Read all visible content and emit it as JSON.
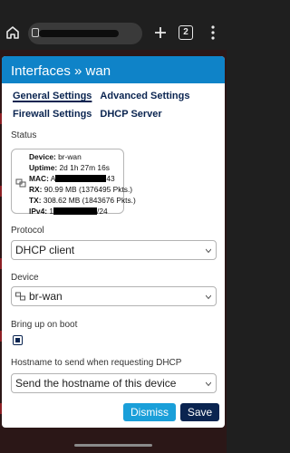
{
  "browser": {
    "tab_count": "2",
    "icons": [
      "home-icon",
      "lock-icon",
      "plus-icon",
      "tabs-icon",
      "menu-icon"
    ]
  },
  "dialog": {
    "title": "Interfaces » wan",
    "tabs": [
      {
        "label": "General Settings",
        "active": true
      },
      {
        "label": "Advanced Settings",
        "active": false
      },
      {
        "label": "Firewall Settings",
        "active": false
      },
      {
        "label": "DHCP Server",
        "active": false
      }
    ],
    "status_label": "Status",
    "status": {
      "device_key": "Device:",
      "device_val": "br-wan",
      "uptime_key": "Uptime:",
      "uptime_val": "2d 1h 27m 16s",
      "mac_key": "MAC:",
      "mac_prefix": "A",
      "mac_suffix": "43",
      "rx_key": "RX:",
      "rx_val": "90.99 MB (1376495 Pkts.)",
      "tx_key": "TX:",
      "tx_val": "308.62 MB (1843676 Pkts.)",
      "ipv4_key": "IPv4:",
      "ipv4_prefix": "1",
      "ipv4_suffix": "/24"
    },
    "protocol_label": "Protocol",
    "protocol_value": "DHCP client",
    "device_label": "Device",
    "device_value": "br-wan",
    "bring_up_label": "Bring up on boot",
    "bring_up_checked": true,
    "hostname_label": "Hostname to send when requesting DHCP",
    "hostname_value": "Send the hostname of this device",
    "dismiss_label": "Dismiss",
    "save_label": "Save"
  },
  "colors": {
    "header": "#0f83c8",
    "primary_dark": "#0a2450",
    "dismiss": "#1a9fd9",
    "backdrop": "#2b1717"
  }
}
